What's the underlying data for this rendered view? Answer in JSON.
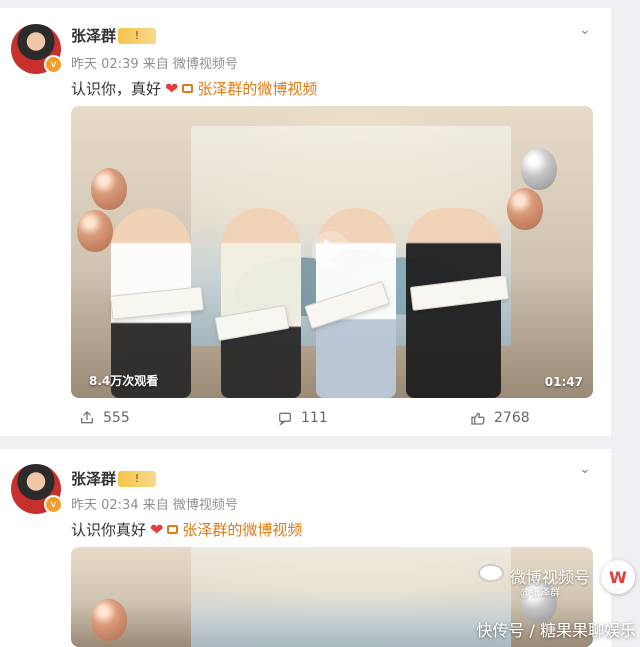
{
  "posts": [
    {
      "user": {
        "name": "张泽群"
      },
      "meta": {
        "time": "昨天 02:39",
        "source_prefix": "来自",
        "source": "微博视频号"
      },
      "text": "认识你，真好",
      "link": "张泽群的微博视频",
      "video": {
        "views": "8.4万次观看",
        "duration": "01:47"
      },
      "actions": {
        "repost": "555",
        "comment": "111",
        "like": "2768"
      }
    },
    {
      "user": {
        "name": "张泽群"
      },
      "meta": {
        "time": "昨天 02:34",
        "source_prefix": "来自",
        "source": "微博视频号"
      },
      "text": "认识你真好",
      "link": "张泽群的微博视频",
      "watermark": {
        "title": "微博视频号",
        "sub": "@张泽群"
      }
    }
  ],
  "bottom_watermark": "快传号 / 糖果果聊娱乐",
  "ui": {
    "badge_text": "!",
    "verified_glyph": "v",
    "sidebar_badge": "W"
  }
}
